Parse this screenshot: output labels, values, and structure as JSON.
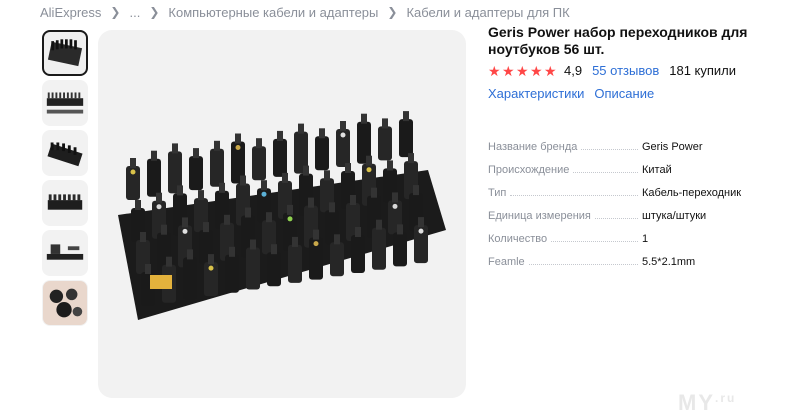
{
  "breadcrumb": {
    "items": [
      "AliExpress",
      "...",
      "Компьютерные кабели и адаптеры",
      "Кабели и адаптеры для ПК"
    ]
  },
  "product": {
    "title": "Geris Power набор переходников для ноутбуков 56 шт.",
    "rating": {
      "value": "4,9",
      "stars": 5,
      "reviews_label": "55 отзывов",
      "sold_label": "181 купили"
    },
    "tabs": [
      "Характеристики",
      "Описание"
    ],
    "specs": [
      {
        "key": "Название бренда",
        "value": "Geris Power"
      },
      {
        "key": "Происхождение",
        "value": "Китай"
      },
      {
        "key": "Тип",
        "value": "Кабель-переходник"
      },
      {
        "key": "Единица измерения",
        "value": "штука/штуки"
      },
      {
        "key": "Количество",
        "value": "1"
      },
      {
        "key": "Feamle",
        "value": "5.5*2.1mm"
      }
    ]
  },
  "gallery": {
    "thumbnail_count": 6,
    "active_index": 0
  },
  "watermark": {
    "text": "MY",
    "suffix": ".ru"
  },
  "colors": {
    "accent_link": "#2e6fd6",
    "star": "#ff4747",
    "muted": "#8a8f99"
  }
}
